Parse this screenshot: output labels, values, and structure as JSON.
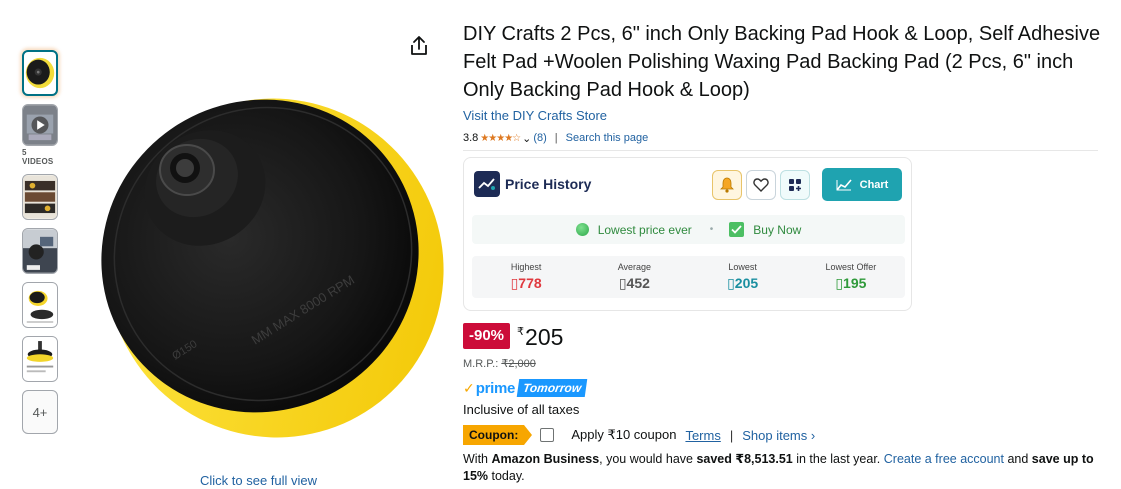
{
  "gallery": {
    "videos_label": "5 VIDEOS",
    "more_label": "4+",
    "full_view_link": "Click to see full view"
  },
  "product": {
    "title": "DIY Crafts 2 Pcs, 6\" inch Only Backing Pad Hook & Loop, Self Adhesive Felt Pad +Woolen Polishing Waxing Pad Backing Pad (2 Pcs, 6\" inch Only Backing Pad Hook & Loop)",
    "store_link": "Visit the DIY Crafts Store",
    "rating": "3.8",
    "rating_count": "(8)",
    "search_page": "Search this page"
  },
  "price_history": {
    "title": "Price History",
    "chart_button": "Chart",
    "status_lowest": "Lowest price ever",
    "status_buy": "Buy Now",
    "stats": [
      {
        "label": "Highest",
        "value": "778",
        "color": "#e0383e"
      },
      {
        "label": "Average",
        "value": "452",
        "color": "#555555"
      },
      {
        "label": "Lowest",
        "value": "205",
        "color": "#1a8fa0"
      },
      {
        "label": "Lowest Offer",
        "value": "195",
        "color": "#2f9a3a"
      }
    ],
    "brand_color": "#1d2b55",
    "accent_color": "#1fa3b0"
  },
  "pricing": {
    "discount": "-90%",
    "currency": "₹",
    "price": "205",
    "mrp_label": "M.R.P.:",
    "mrp_value": "₹2,000",
    "prime_label": "prime",
    "prime_delivery": "Tomorrow",
    "inclusive": "Inclusive of all taxes",
    "coupon_badge": "Coupon:",
    "coupon_text": "Apply ₹10 coupon",
    "terms_link": "Terms",
    "shop_items_link": "Shop items ›"
  },
  "business": {
    "prefix": "With ",
    "brand": "Amazon Business",
    "mid1": ", you would have ",
    "saved_label": "saved ₹8,513.51",
    "mid2": " in the last year. ",
    "create_link": "Create a free account",
    "mid3": " and ",
    "save_up": "save up to 15%",
    "suffix": " today."
  }
}
